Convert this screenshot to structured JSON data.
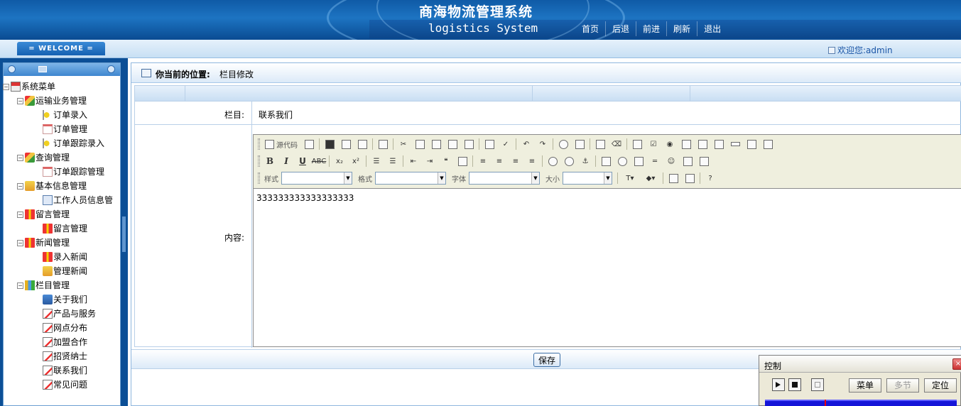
{
  "header": {
    "title": "商海物流管理系统",
    "subtitle": "logistics System",
    "nav": [
      "首页",
      "后退",
      "前进",
      "刷新",
      "退出"
    ]
  },
  "welcome_bar": {
    "tab_label": "= WELCOME =",
    "greeting": "欢迎您:admin"
  },
  "sidebar": {
    "root": "系统菜单",
    "groups": [
      {
        "label": "运输业务管理",
        "items": [
          "订单录入",
          "订单管理",
          "订单跟踪录入"
        ]
      },
      {
        "label": "查询管理",
        "items": [
          "订单跟踪管理"
        ]
      },
      {
        "label": "基本信息管理",
        "items": [
          "工作人员信息管"
        ]
      },
      {
        "label": "留言管理",
        "items": [
          "留言管理"
        ]
      },
      {
        "label": "新闻管理",
        "items": [
          "录入新闻",
          "管理新闻"
        ]
      },
      {
        "label": "栏目管理",
        "items": [
          "关于我们",
          "产品与服务",
          "网点分布",
          "加盟合作",
          "招贤纳士",
          "联系我们",
          "常见问题"
        ]
      }
    ]
  },
  "location": {
    "label": "你当前的位置:",
    "value": "栏目修改"
  },
  "form": {
    "column_label": "栏目:",
    "column_value": "联系我们",
    "content_label": "内容:",
    "editor": {
      "source_label": "源代码",
      "style_label": "样式",
      "format_label": "格式",
      "font_label": "字体",
      "size_label": "大小",
      "body_text": "333333333333333333"
    },
    "save_label": "保存"
  },
  "player": {
    "title": "控制",
    "buttons": [
      "菜单",
      "多节",
      "定位"
    ]
  },
  "colors": {
    "header_blue": "#1d74c2",
    "link_blue": "#1a55a6",
    "player_track": "#1515d8"
  }
}
